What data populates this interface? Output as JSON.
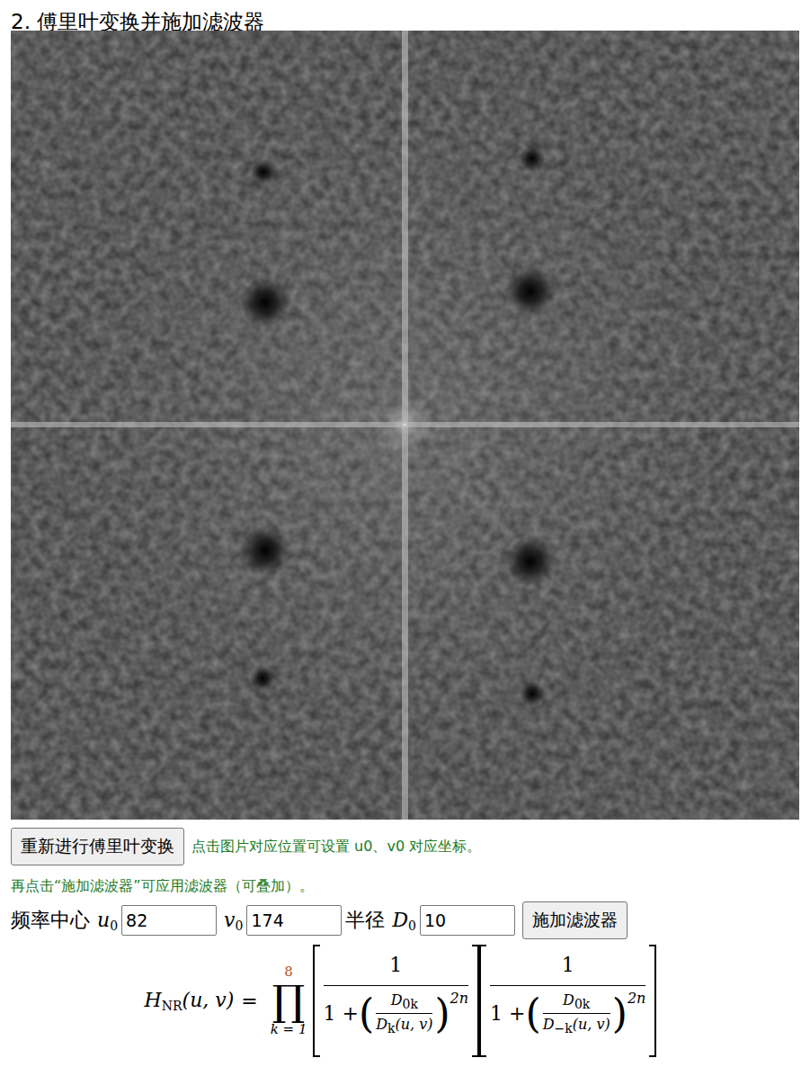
{
  "title": "2. 傅里叶变换并施加滤波器",
  "buttons": {
    "refft": "重新进行傅里叶变换",
    "apply": "施加滤波器"
  },
  "hints": [
    "点击图片对应位置可设置 u0、v0 对应坐标。",
    "再点击“施加滤波器”可应用滤波器（可叠加）。"
  ],
  "form": {
    "center_label": "频率中心",
    "u_label": "u",
    "u_sub": "0",
    "u_value": "82",
    "v_label": "v",
    "v_sub": "0",
    "v_value": "174",
    "radius_label": "半径",
    "d_label": "D",
    "d_sub": "0",
    "d_value": "10"
  },
  "formula": {
    "lhs": "H",
    "lhs_sub": "NR",
    "lhs_args": "(u, v)",
    "eq": "=",
    "prod": "∏",
    "upper": "8",
    "lower": "k = 1",
    "factors": [
      {
        "num": "1",
        "one": "1 +",
        "open": "(",
        "close": ")",
        "top": "D",
        "top_sub": "0k",
        "bot": "D",
        "bot_sub": "k",
        "bot_args": "(u, v)",
        "exp": "2n"
      },
      {
        "num": "1",
        "one": "1 +",
        "open": "(",
        "close": ")",
        "top": "D",
        "top_sub": "0k",
        "bot": "D",
        "bot_sub": "−k",
        "bot_args": "(u, v)",
        "exp": "2n"
      }
    ]
  }
}
